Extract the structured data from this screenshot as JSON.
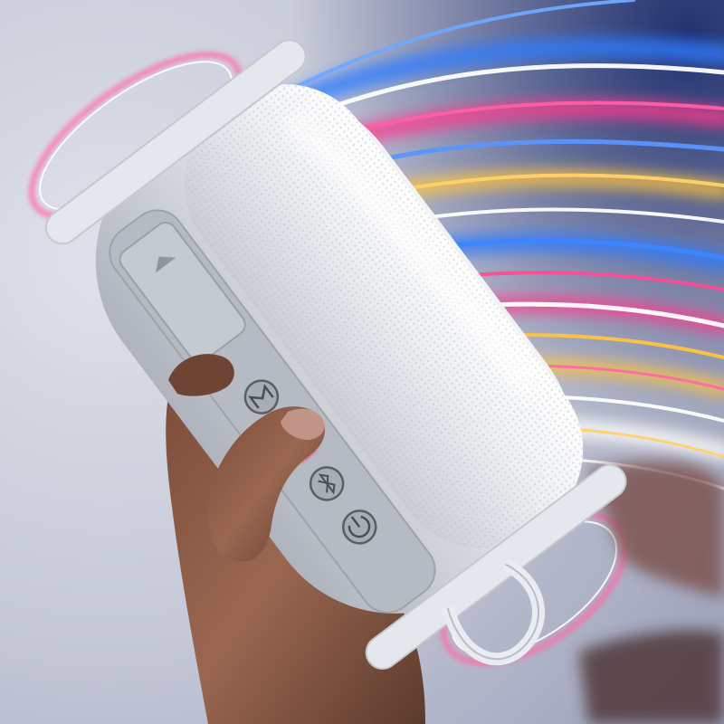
{
  "scene": {
    "subject": "portable-bluetooth-speaker",
    "background_color": "#c9ccd8",
    "speaker_color": "#d9dde3",
    "mesh_color": "#eef0f3",
    "skin_color": "#8a5a45",
    "glow_colors": [
      "#ff3b8d",
      "#2f7bff",
      "#ffc53d",
      "#ffffff",
      "#8f4bff"
    ],
    "buttons": [
      {
        "icon": "mode-icon",
        "state": "idle"
      },
      {
        "icon": "play-pause-icon",
        "state": "active-glow"
      },
      {
        "icon": "bluetooth-icon",
        "state": "idle"
      },
      {
        "icon": "power-icon",
        "state": "idle"
      }
    ],
    "accessories": [
      "charging-port-cover",
      "carry-strap"
    ]
  }
}
